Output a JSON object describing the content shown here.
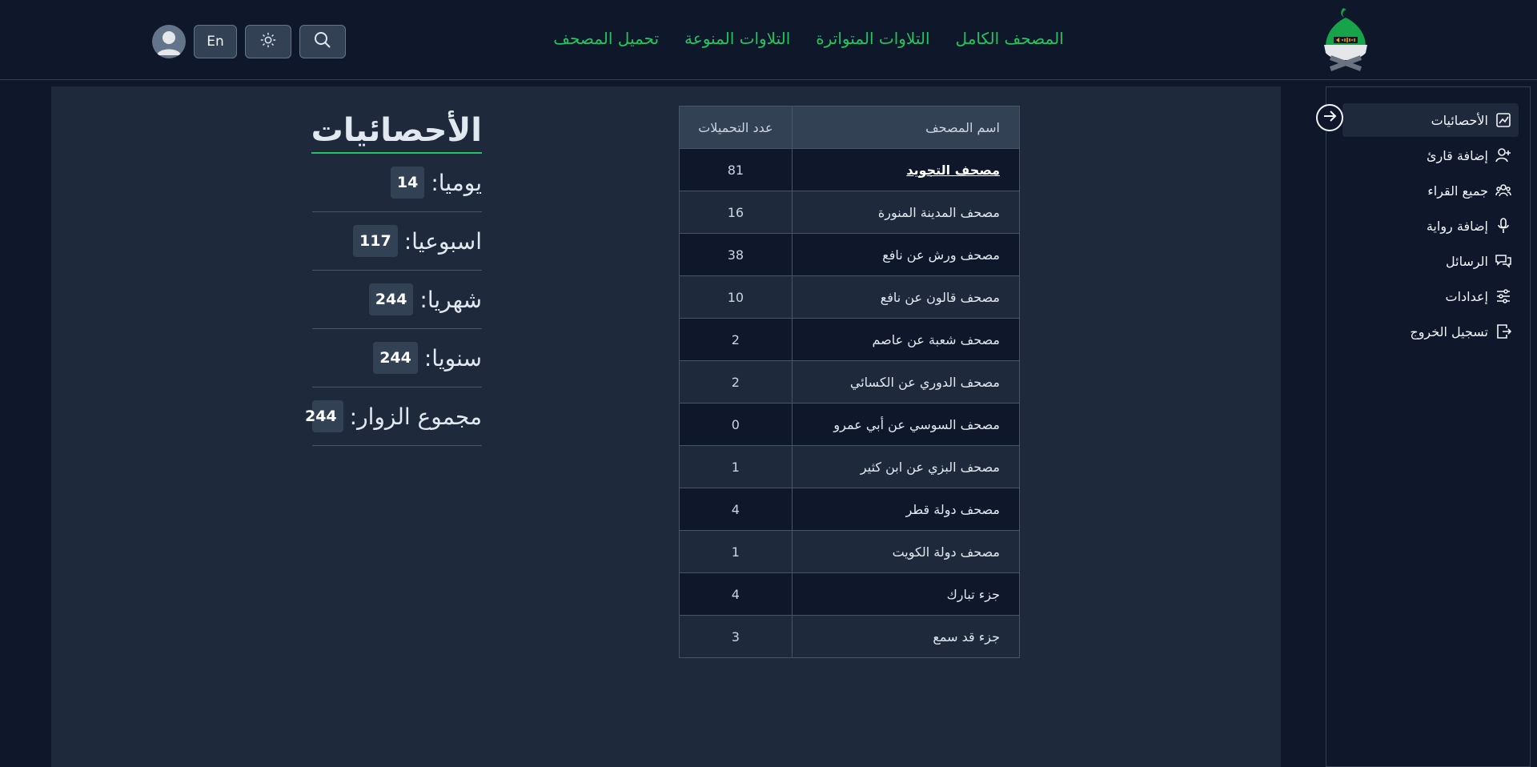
{
  "header": {
    "nav": [
      {
        "label": "المصحف الكامل"
      },
      {
        "label": "التلاوات المتواترة"
      },
      {
        "label": "التلاوات المنوعة"
      },
      {
        "label": "تحميل المصحف"
      }
    ],
    "lang_button": "En",
    "icons": {
      "search": "search-icon",
      "theme": "sun-icon",
      "user": "user-avatar-icon"
    }
  },
  "sidebar": {
    "items": [
      {
        "label": "الأحصائيات",
        "icon": "chart-line-icon",
        "active": true
      },
      {
        "label": "إضافة قارئ",
        "icon": "user-plus-icon"
      },
      {
        "label": "جميع القراء",
        "icon": "users-icon"
      },
      {
        "label": "إضافة رواية",
        "icon": "microphone-icon"
      },
      {
        "label": "الرسائل",
        "icon": "chat-icon"
      },
      {
        "label": "إعدادات",
        "icon": "sliders-icon"
      },
      {
        "label": "تسجيل الخروج",
        "icon": "logout-icon"
      }
    ]
  },
  "table": {
    "headers": {
      "name": "اسم المصحف",
      "count": "عدد التحميلات"
    },
    "rows": [
      {
        "name": "مصحف التجويد",
        "count": "81"
      },
      {
        "name": "مصحف المدينة المنورة",
        "count": "16"
      },
      {
        "name": "مصحف ورش عن نافع",
        "count": "38"
      },
      {
        "name": "مصحف قالون عن نافع",
        "count": "10"
      },
      {
        "name": "مصحف شعبة عن عاصم",
        "count": "2"
      },
      {
        "name": "مصحف الدوري عن الكسائي",
        "count": "2"
      },
      {
        "name": "مصحف السوسي عن أبي عمرو",
        "count": "0"
      },
      {
        "name": "مصحف البزي عن ابن كثير",
        "count": "1"
      },
      {
        "name": "مصحف دولة قطر",
        "count": "4"
      },
      {
        "name": "مصحف دولة الكويت",
        "count": "1"
      },
      {
        "name": "جزء تبارك",
        "count": "4"
      },
      {
        "name": "جزء قد سمع",
        "count": "3"
      }
    ]
  },
  "stats": {
    "title": "الأحصائيات",
    "items": [
      {
        "label": "يوميا:",
        "value": "14"
      },
      {
        "label": "اسبوعيا:",
        "value": "117"
      },
      {
        "label": "شهريا:",
        "value": "244"
      },
      {
        "label": "سنويا:",
        "value": "244"
      },
      {
        "label": "مجموع الزوار:",
        "value": "244"
      }
    ]
  },
  "colors": {
    "accent": "#22c55e",
    "background": "#0f172a",
    "panel": "#1e293b"
  }
}
